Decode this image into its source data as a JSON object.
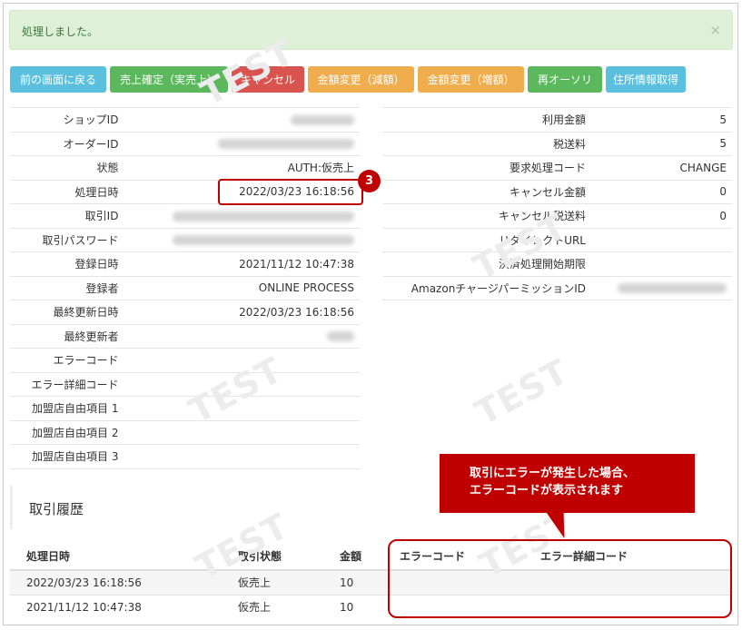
{
  "alert": {
    "message": "処理しました。",
    "close_symbol": "×"
  },
  "toolbar": {
    "back": "前の画面に戻る",
    "confirm_sale": "売上確定（実売上）",
    "cancel": "キャンセル",
    "amount_change_decrease": "金額変更（減額）",
    "amount_change_increase": "金額変更（増額）",
    "reauthorize": "再オーソリ",
    "get_address": "住所情報取得"
  },
  "details_left": [
    {
      "label": "ショップID",
      "value": ""
    },
    {
      "label": "オーダーID",
      "value": ""
    },
    {
      "label": "状態",
      "value": "AUTH:仮売上"
    },
    {
      "label": "処理日時",
      "value": "2022/03/23 16:18:56"
    },
    {
      "label": "取引ID",
      "value": ""
    },
    {
      "label": "取引パスワード",
      "value": ""
    },
    {
      "label": "登録日時",
      "value": "2021/11/12 10:47:38"
    },
    {
      "label": "登録者",
      "value": "ONLINE PROCESS"
    },
    {
      "label": "最終更新日時",
      "value": "2022/03/23 16:18:56"
    },
    {
      "label": "最終更新者",
      "value": ""
    },
    {
      "label": "エラーコード",
      "value": ""
    },
    {
      "label": "エラー詳細コード",
      "value": ""
    },
    {
      "label": "加盟店自由項目 1",
      "value": ""
    },
    {
      "label": "加盟店自由項目 2",
      "value": ""
    },
    {
      "label": "加盟店自由項目 3",
      "value": ""
    }
  ],
  "details_right": [
    {
      "label": "利用金額",
      "value": "5"
    },
    {
      "label": "税送料",
      "value": "5"
    },
    {
      "label": "要求処理コード",
      "value": "CHANGE"
    },
    {
      "label": "キャンセル金額",
      "value": "0"
    },
    {
      "label": "キャンセル税送料",
      "value": "0"
    },
    {
      "label": "リダイレクトURL",
      "value": ""
    },
    {
      "label": "決済処理開始期限",
      "value": ""
    },
    {
      "label": "AmazonチャージパーミッションID",
      "value": ""
    }
  ],
  "history": {
    "title": "取引履歴",
    "columns": [
      "処理日時",
      "取引状態",
      "金額",
      "エラーコード",
      "エラー詳細コード"
    ],
    "rows": [
      [
        "2022/03/23 16:18:56",
        "仮売上",
        "10",
        "",
        ""
      ],
      [
        "2021/11/12 10:47:38",
        "仮売上",
        "10",
        "",
        ""
      ]
    ]
  },
  "callout": {
    "line1": "取引にエラーが発生した場合、",
    "line2": "エラーコードが表示されます"
  },
  "badge_number": "3",
  "watermark": "TEST",
  "colors": {
    "alert_bg": "#dff0d8",
    "alert_text": "#3c763d",
    "info": "#5bc0de",
    "success": "#5cb85c",
    "danger": "#d9534f",
    "warning": "#f0ad4e",
    "annotation_red": "#c00000"
  }
}
